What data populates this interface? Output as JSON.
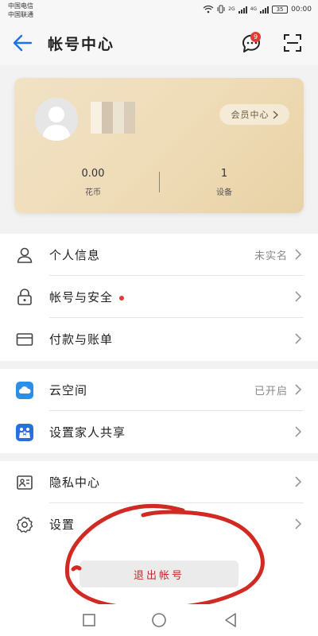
{
  "status_bar": {
    "carrier1": "中国电信",
    "carrier2": "中国联通",
    "net1": "2G",
    "net2": "4G",
    "battery": "35",
    "time": "00:00"
  },
  "header": {
    "title": "帐号中心",
    "message_badge": "9"
  },
  "card": {
    "member_button": "会员中心",
    "coins_value": "0.00",
    "coins_label": "花币",
    "devices_value": "1",
    "devices_label": "设备"
  },
  "section1": {
    "items": [
      {
        "label": "个人信息",
        "value": "未实名",
        "icon": "person-icon"
      },
      {
        "label": "帐号与安全",
        "value": "",
        "icon": "lock-icon"
      },
      {
        "label": "付款与账单",
        "value": "",
        "icon": "card-icon"
      }
    ]
  },
  "section2": {
    "items": [
      {
        "label": "云空间",
        "value": "已开启",
        "icon": "cloud-icon"
      },
      {
        "label": "设置家人共享",
        "value": "",
        "icon": "family-share-icon"
      }
    ]
  },
  "section3": {
    "items": [
      {
        "label": "隐私中心",
        "value": "",
        "icon": "privacy-icon"
      },
      {
        "label": "设置",
        "value": "",
        "icon": "settings-icon"
      }
    ]
  },
  "logout": {
    "label": "退出帐号"
  },
  "colors": {
    "accent_blue": "#1a73e8",
    "red": "#e53935",
    "card_gold": "#efdcb8"
  }
}
